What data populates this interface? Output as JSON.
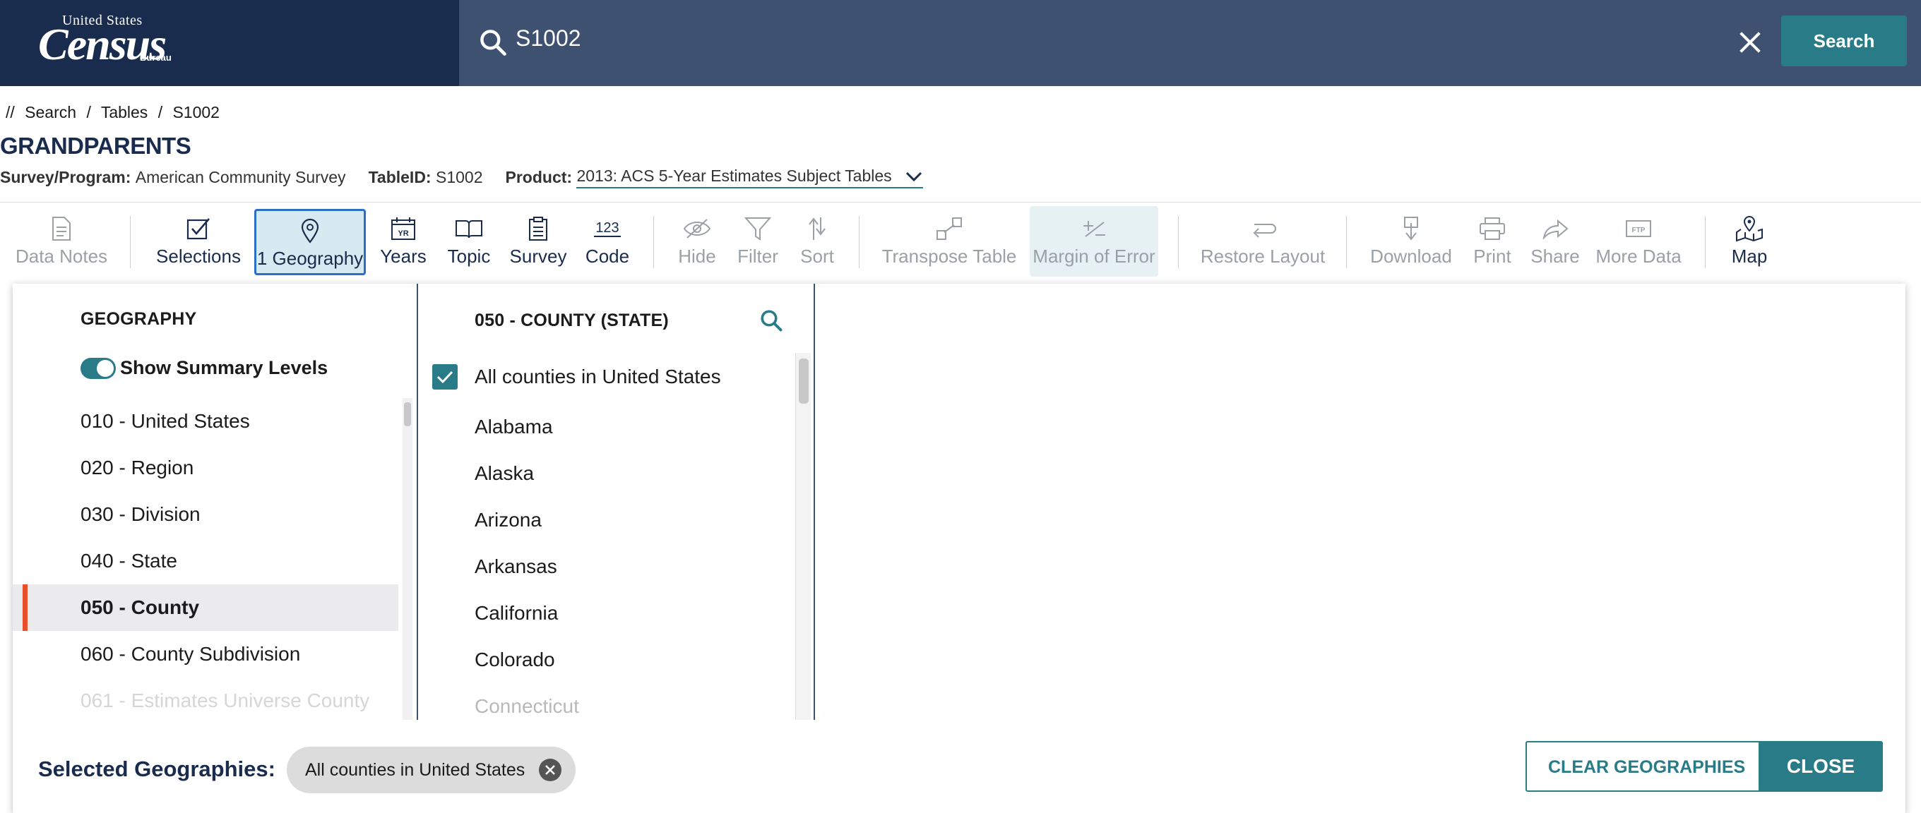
{
  "header": {
    "logo_line1": "United States",
    "logo_line2": "Census",
    "logo_line3": "Bureau",
    "search_value": "S1002",
    "search_button": "Search"
  },
  "breadcrumb": [
    "//",
    "Search",
    "/",
    "Tables",
    "/",
    "S1002"
  ],
  "page_title": "GRANDPARENTS",
  "meta": {
    "survey_label": "Survey/Program:",
    "survey_value": "American Community Survey",
    "table_label": "TableID:",
    "table_value": "S1002",
    "product_label": "Product:",
    "product_value": "2013: ACS 5-Year Estimates Subject Tables"
  },
  "toolbar": [
    {
      "label": "Data Notes",
      "icon": "document-icon"
    },
    {
      "label": "Selections",
      "icon": "checkbox-icon"
    },
    {
      "label": "1 Geography",
      "icon": "location-pin-icon"
    },
    {
      "label": "Years",
      "icon": "calendar-icon"
    },
    {
      "label": "Topic",
      "icon": "book-icon"
    },
    {
      "label": "Survey",
      "icon": "clipboard-icon"
    },
    {
      "label": "Code",
      "icon": "code-123-icon"
    },
    {
      "label": "Hide",
      "icon": "eye-slash-icon"
    },
    {
      "label": "Filter",
      "icon": "filter-icon"
    },
    {
      "label": "Sort",
      "icon": "sort-icon"
    },
    {
      "label": "Transpose Table",
      "icon": "transpose-icon"
    },
    {
      "label": "Margin of Error",
      "icon": "plus-minus-icon"
    },
    {
      "label": "Restore Layout",
      "icon": "restore-icon"
    },
    {
      "label": "Download",
      "icon": "download-icon"
    },
    {
      "label": "Print",
      "icon": "print-icon"
    },
    {
      "label": "Share",
      "icon": "share-icon"
    },
    {
      "label": "More Data",
      "icon": "ftp-icon"
    },
    {
      "label": "Map",
      "icon": "map-icon"
    }
  ],
  "geography_panel": {
    "heading": "GEOGRAPHY",
    "toggle_label": "Show Summary Levels",
    "levels": [
      "010 - United States",
      "020 - Region",
      "030 - Division",
      "040 - State",
      "050 - County",
      "060 - County Subdivision",
      "061 - Estimates Universe County"
    ],
    "selected_level": "050 - County"
  },
  "county_panel": {
    "heading": "050 - COUNTY (STATE)",
    "all_option": "All counties in United States",
    "states": [
      "Alabama",
      "Alaska",
      "Arizona",
      "Arkansas",
      "California",
      "Colorado",
      "Connecticut"
    ]
  },
  "footer": {
    "selected_label": "Selected Geographies:",
    "chip": "All counties in United States",
    "clear_button": "CLEAR GEOGRAPHIES",
    "close_button": "CLOSE"
  },
  "colors": {
    "header_bg": "#3e5170",
    "logo_bg": "#1a2c4e",
    "accent": "#2a7b88",
    "selected_marker": "#e8502a"
  }
}
